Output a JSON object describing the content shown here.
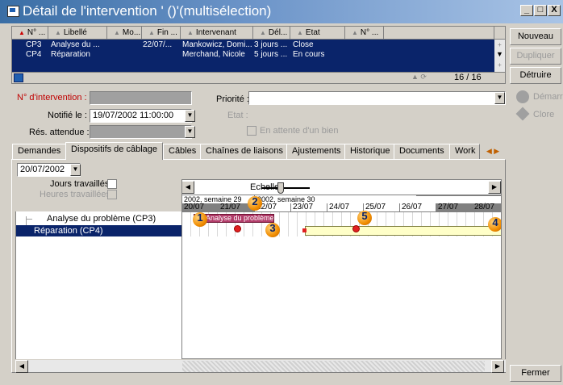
{
  "window": {
    "title": "Détail de l'intervention ' ()'(multisélection)"
  },
  "window_buttons": {
    "minimize": "_",
    "maximize": "□",
    "close": "X"
  },
  "right_buttons": {
    "new": "Nouveau",
    "duplicate": "Dupliquer",
    "delete": "Détruire",
    "close": "Fermer"
  },
  "action_buttons": {
    "start": "Démarr",
    "close": "Clore"
  },
  "grid": {
    "columns": [
      "N° ...",
      "Libellé",
      "Mo...",
      "Fin ...",
      "Intervenant",
      "Dél...",
      "Etat",
      "N° ..."
    ],
    "rows": [
      [
        "CP3",
        "Analyse du ...",
        "",
        "22/07/...",
        "Mankowicz, Domi...",
        "3 jours ...",
        "Close",
        ""
      ],
      [
        "CP4",
        "Réparation",
        "",
        "",
        "Merchand, Nicole",
        "5 jours ...",
        "En cours",
        ""
      ]
    ],
    "counter": "16 / 16"
  },
  "form": {
    "intervention_number_label": "N° d'intervention :",
    "notified_label": "Notifié le :",
    "notified_value": "19/07/2002 11:00:00",
    "expected_label": "Rés. attendue :",
    "priority_label": "Priorité :",
    "state_label": "Etat :",
    "waiting_label": "En attente d'un bien"
  },
  "tabs": [
    "Demandes",
    "Dispositifs de câblage",
    "Câbles",
    "Chaînes de liaisons",
    "Ajustements",
    "Historique",
    "Documents",
    "Work"
  ],
  "gantt": {
    "date_value": "20/07/2002",
    "worked_days_label": "Jours travaillés",
    "worked_hours_label": "Heures travaillées",
    "scale_label": "Echelle :",
    "weeks": [
      "2002, semaine 29",
      "2002, semaine 30"
    ],
    "days": [
      "20/07",
      "21/07",
      "22/07",
      "23/07",
      "24/07",
      "25/07",
      "26/07",
      "27/07",
      "28/07"
    ],
    "tasks": [
      "Analyse du problème (CP3)",
      "Réparation (CP4)"
    ],
    "bar_label": "Analyse du problème",
    "markers": [
      "1",
      "2",
      "3",
      "4",
      "5"
    ],
    "colors": {
      "selected": "#0a246a",
      "bar1": "#b23c6a",
      "bar2": "#ffffc8",
      "weekend": "#808080"
    }
  }
}
